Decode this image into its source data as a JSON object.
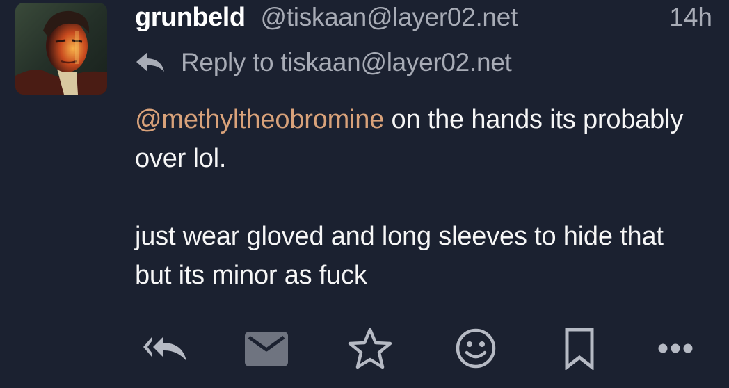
{
  "status": {
    "display_name": "grunbeld",
    "account": "@tiskaan@layer02.net",
    "timestamp": "14h",
    "reply_to": "Reply to tiskaan@layer02.net",
    "mention": "@methyltheobromine",
    "paragraph_1_rest": " on the hands its probably over lol.",
    "paragraph_2": "just wear gloved and long sleeves to hide that but its minor as fuck"
  },
  "actions": [
    "reply-all-icon",
    "mail-icon",
    "star-icon",
    "emoji-icon",
    "bookmark-icon",
    "more-icon"
  ],
  "colors": {
    "background": "#1b2130",
    "mention": "#d9a27a",
    "muted": "#a8acb6",
    "icon": "#b6bac4"
  }
}
